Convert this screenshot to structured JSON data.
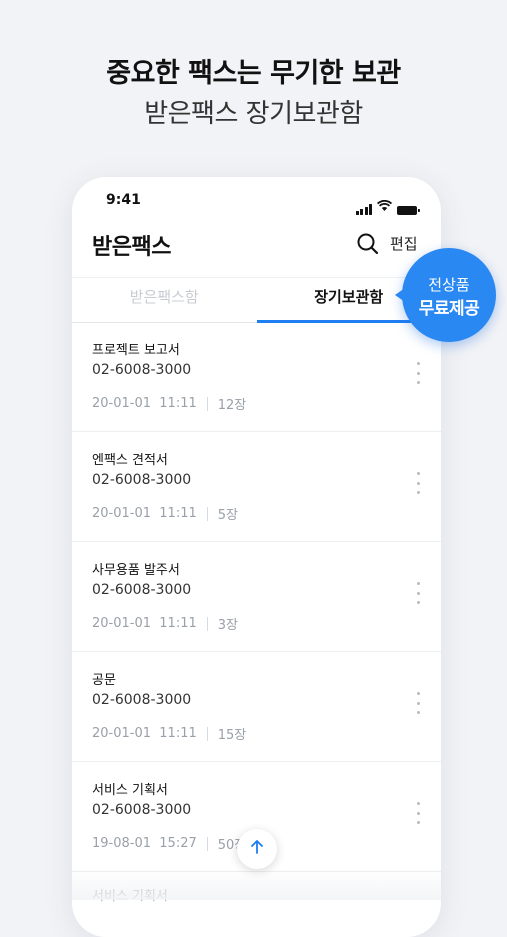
{
  "promo": {
    "title": "중요한 팩스는 무기한 보관",
    "subtitle": "받은팩스 장기보관함"
  },
  "status_bar": {
    "time": "9:41",
    "icons": [
      "signal-icon",
      "wifi-icon",
      "battery-icon"
    ]
  },
  "header": {
    "title": "받은팩스",
    "edit_label": "편집",
    "search_icon": "search-icon"
  },
  "tabs": [
    {
      "label": "받은팩스함",
      "active": false
    },
    {
      "label": "장기보관함",
      "active": true
    }
  ],
  "badge": {
    "line1": "전상품",
    "line2": "무료제공"
  },
  "fax_items": [
    {
      "title": "프로젝트 보고서",
      "number": "02-6008-3000",
      "date": "20-01-01",
      "time": "11:11",
      "pages": "12장"
    },
    {
      "title": "엔팩스 견적서",
      "number": "02-6008-3000",
      "date": "20-01-01",
      "time": "11:11",
      "pages": "5장"
    },
    {
      "title": "사무용품 발주서",
      "number": "02-6008-3000",
      "date": "20-01-01",
      "time": "11:11",
      "pages": "3장"
    },
    {
      "title": "공문",
      "number": "02-6008-3000",
      "date": "20-01-01",
      "time": "11:11",
      "pages": "15장"
    },
    {
      "title": "서비스 기획서",
      "number": "02-6008-3000",
      "date": "19-08-01",
      "time": "15:27",
      "pages": "50장"
    }
  ],
  "partial_item": {
    "title": "서비스 기획서"
  },
  "colors": {
    "accent": "#1f7ef0",
    "badge": "#2a88f2",
    "background": "#f2f3f6"
  },
  "scroll_top_icon": "arrow-up-icon"
}
